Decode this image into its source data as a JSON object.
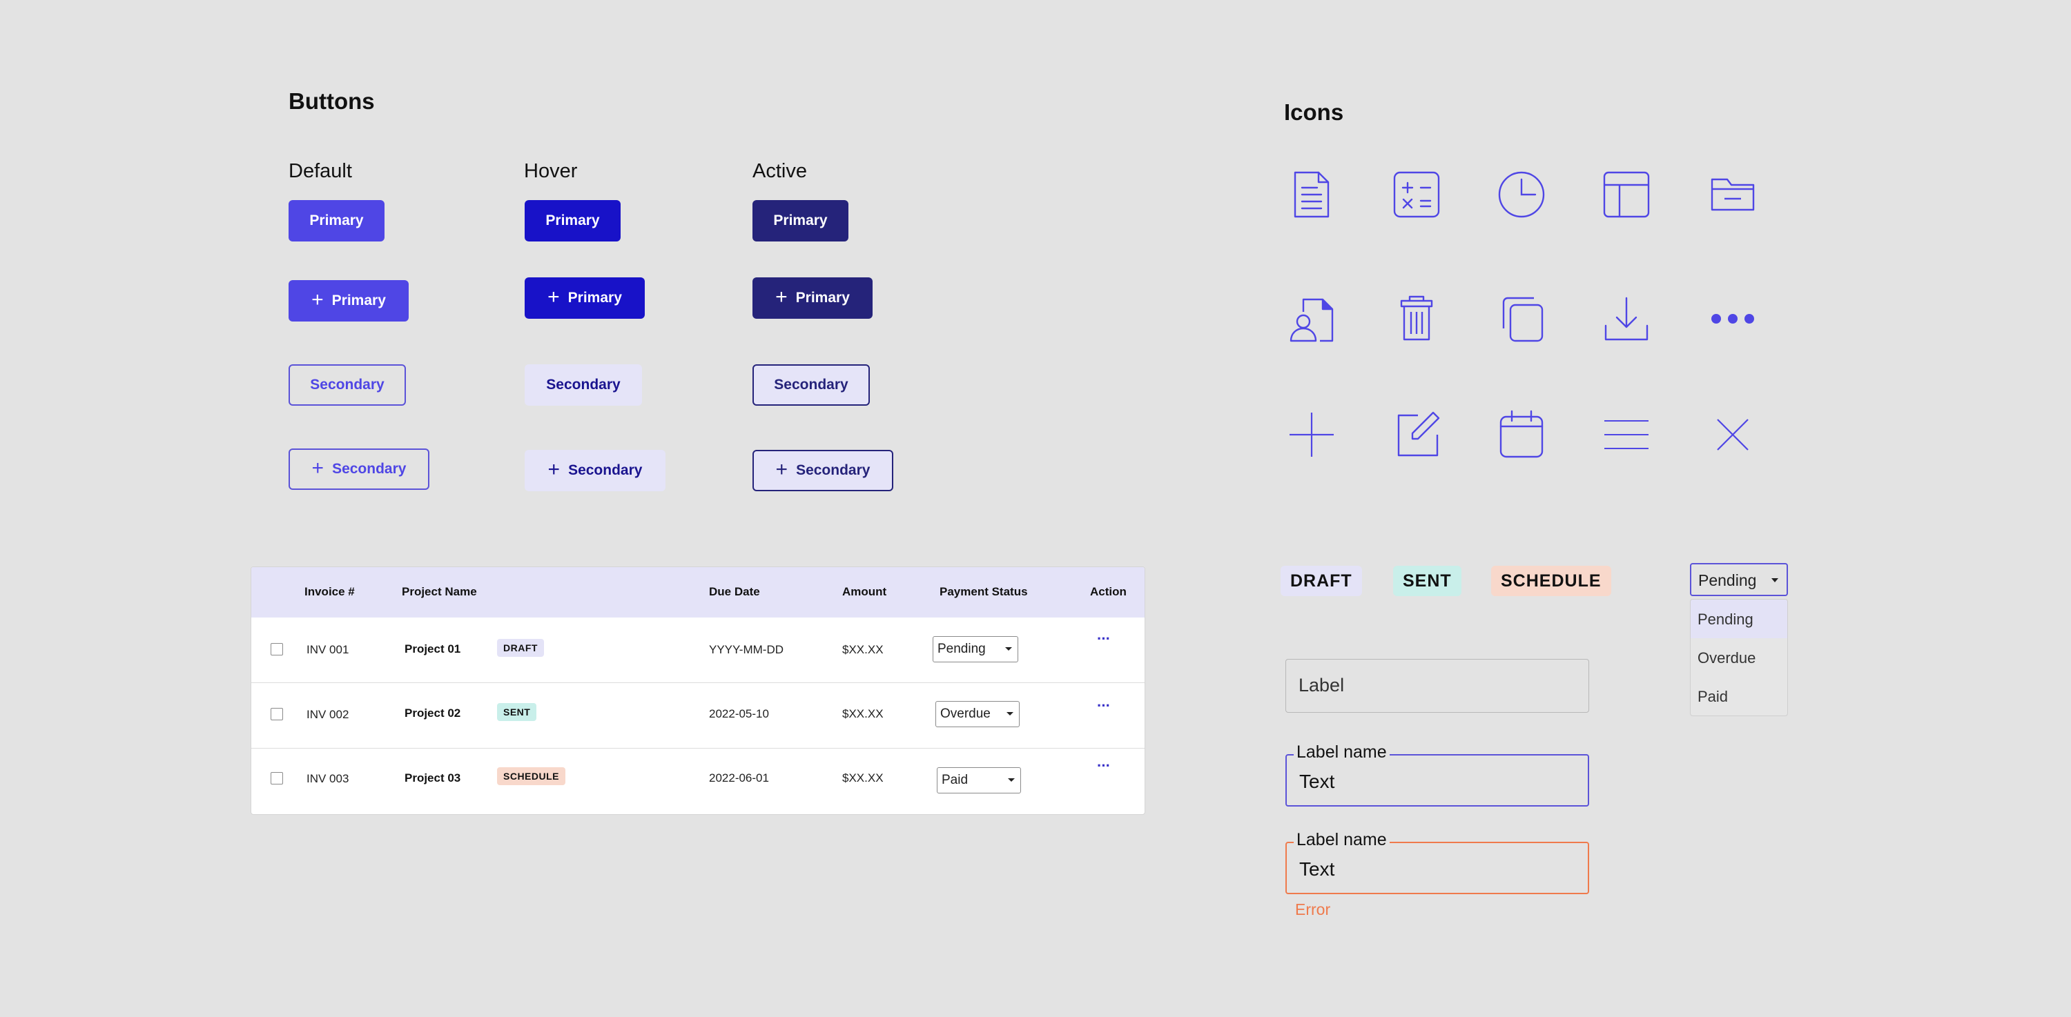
{
  "buttons_section": {
    "title": "Buttons",
    "states": [
      "Default",
      "Hover",
      "Active"
    ],
    "primary_label": "Primary",
    "secondary_label": "Secondary",
    "add_symbol": "+"
  },
  "icons_section": {
    "title": "Icons",
    "icon_color": "#4f46e5",
    "icons": [
      "document-icon",
      "calculator-icon",
      "clock-icon",
      "layout-icon",
      "folder-icon",
      "user-document-icon",
      "trash-icon",
      "copy-icon",
      "download-icon",
      "more-icon",
      "plus-icon",
      "edit-icon",
      "calendar-icon",
      "menu-icon",
      "close-icon"
    ]
  },
  "status_badges": [
    "DRAFT",
    "SENT",
    "SCHEDULE"
  ],
  "colors": {
    "primary": "#4f46e5",
    "primary_hover": "#1812c8",
    "primary_active": "#25237a",
    "secondary_bg": "#e5e4f8",
    "draft_bg": "#e4e3f7",
    "sent_bg": "#c9efea",
    "schedule_bg": "#f8d8cb",
    "error": "#ef7a4c",
    "background": "#e3e3e3"
  },
  "table": {
    "headers": [
      "Invoice #",
      "Project Name",
      "Due Date",
      "Amount",
      "Payment Status",
      "Action"
    ],
    "rows": [
      {
        "invoice": "INV 001",
        "project": "Project 01",
        "badge": "DRAFT",
        "due": "YYYY-MM-DD",
        "amount": "$XX.XX",
        "status": "Pending",
        "action": "···"
      },
      {
        "invoice": "INV 002",
        "project": "Project 02",
        "badge": "SENT",
        "due": "2022-05-10",
        "amount": "$XX.XX",
        "status": "Overdue",
        "action": "···"
      },
      {
        "invoice": "INV 003",
        "project": "Project 03",
        "badge": "SCHEDULE",
        "due": "2022-06-01",
        "amount": "$XX.XX",
        "status": "Paid",
        "action": "···"
      }
    ]
  },
  "form": {
    "empty_field": {
      "placeholder": "Label"
    },
    "focused_field": {
      "label": "Label name",
      "value": "Text"
    },
    "error_field": {
      "label": "Label name",
      "value": "Text",
      "error": "Error"
    }
  },
  "dropdown": {
    "selected": "Pending",
    "options": [
      "Pending",
      "Overdue",
      "Paid"
    ],
    "highlighted_index": 0
  }
}
